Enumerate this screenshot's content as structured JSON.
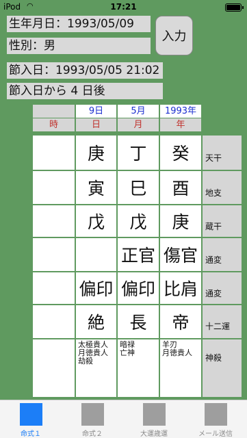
{
  "status": {
    "carrier": "iPod",
    "time": "17:21"
  },
  "fields": {
    "birthdate": "生年月日：1993/05/09",
    "gender": "性別：男",
    "setsuiri": "節入日：1993/05/05 21:02",
    "after": "節入日から 4 日後"
  },
  "input_button": "入力",
  "headers": {
    "day_val": "9日",
    "month_val": "5月",
    "year_val": "1993年",
    "time": "時",
    "day": "日",
    "month": "月",
    "year": "年"
  },
  "rows": [
    {
      "label": "天干",
      "c": [
        "",
        "庚",
        "丁",
        "癸"
      ]
    },
    {
      "label": "地支",
      "c": [
        "",
        "寅",
        "巳",
        "酉"
      ]
    },
    {
      "label": "蔵干",
      "c": [
        "",
        "戊",
        "戊",
        "庚"
      ]
    },
    {
      "label": "通変",
      "c": [
        "",
        "",
        "正官",
        "傷官"
      ]
    },
    {
      "label": "通変",
      "c": [
        "",
        "偏印",
        "偏印",
        "比肩"
      ]
    },
    {
      "label": "十二運",
      "c": [
        "",
        "絶",
        "長",
        "帝"
      ]
    }
  ],
  "shinsatsu": {
    "label": "神殺",
    "c": [
      [],
      [
        "太極貴人",
        "月徳貴人",
        "劫殺"
      ],
      [
        "暗禄",
        "亡神"
      ],
      [
        "羊刃",
        "月徳貴人"
      ]
    ]
  },
  "tabs": [
    {
      "label": "命式１",
      "active": true
    },
    {
      "label": "命式２",
      "active": false
    },
    {
      "label": "大運歳運",
      "active": false
    },
    {
      "label": "メール送信",
      "active": false
    }
  ]
}
